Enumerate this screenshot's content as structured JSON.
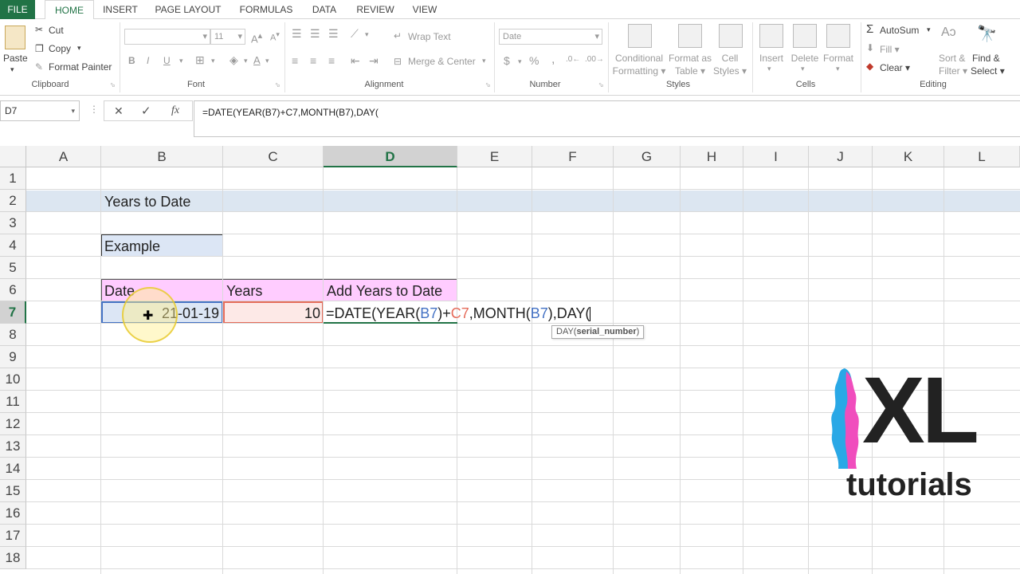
{
  "ribbon_tabs": [
    "FILE",
    "HOME",
    "INSERT",
    "PAGE LAYOUT",
    "FORMULAS",
    "DATA",
    "REVIEW",
    "VIEW"
  ],
  "clipboard": {
    "paste": "Paste",
    "cut": "Cut",
    "copy": "Copy",
    "format_painter": "Format Painter",
    "label": "Clipboard"
  },
  "font": {
    "size": "11",
    "label": "Font",
    "bold": "B",
    "italic": "I",
    "underline": "U"
  },
  "alignment": {
    "wrap_text": "Wrap Text",
    "merge_center": "Merge & Center",
    "label": "Alignment"
  },
  "number": {
    "format": "Date",
    "currency": "$",
    "percent": "%",
    "comma": ",",
    "label": "Number"
  },
  "styles": {
    "conditional": "Conditional",
    "formatting": "Formatting",
    "format_as": "Format as",
    "table": "Table",
    "cell": "Cell",
    "cell_styles": "Styles",
    "label": "Styles"
  },
  "cells": {
    "insert": "Insert",
    "delete": "Delete",
    "format": "Format",
    "label": "Cells"
  },
  "editing": {
    "autosum": "AutoSum",
    "fill": "Fill",
    "clear": "Clear",
    "sort": "Sort &",
    "filter": "Filter",
    "find": "Find &",
    "select": "Select",
    "label": "Editing"
  },
  "formula_bar": {
    "name_box": "D7",
    "cancel": "✕",
    "enter": "✓",
    "fx": "fx",
    "formula": "=DATE(YEAR(B7)+C7,MONTH(B7),DAY("
  },
  "columns": [
    "A",
    "B",
    "C",
    "D",
    "E",
    "F",
    "G",
    "H",
    "I",
    "J",
    "K",
    "L"
  ],
  "rows": [
    "1",
    "2",
    "3",
    "4",
    "5",
    "6",
    "7",
    "8",
    "9",
    "10",
    "11",
    "12",
    "13",
    "14",
    "15",
    "16",
    "17",
    "18"
  ],
  "cells_content": {
    "b2": "Years to Date",
    "b4": "Example",
    "b6": "Date",
    "c6": "Years",
    "d6": "Add Years to Date",
    "b7": "21-01-19",
    "c7": "10",
    "d7_parts": [
      "=DATE(YEAR(",
      "B7",
      ")+",
      "C7",
      ",MONTH(",
      "B7",
      "),DAY("
    ]
  },
  "tooltip": {
    "fn": "DAY(",
    "arg": "serial_number",
    "close": ")"
  },
  "logo": {
    "big": "XL",
    "small": "tutorials"
  },
  "colors": {
    "excel_green": "#217346",
    "title_band": "#dce6f1",
    "header_pink": "#ffccff",
    "example_fill": "#dce6f5",
    "date_ref": "#4472c4",
    "years_ref": "#e56b5a"
  }
}
